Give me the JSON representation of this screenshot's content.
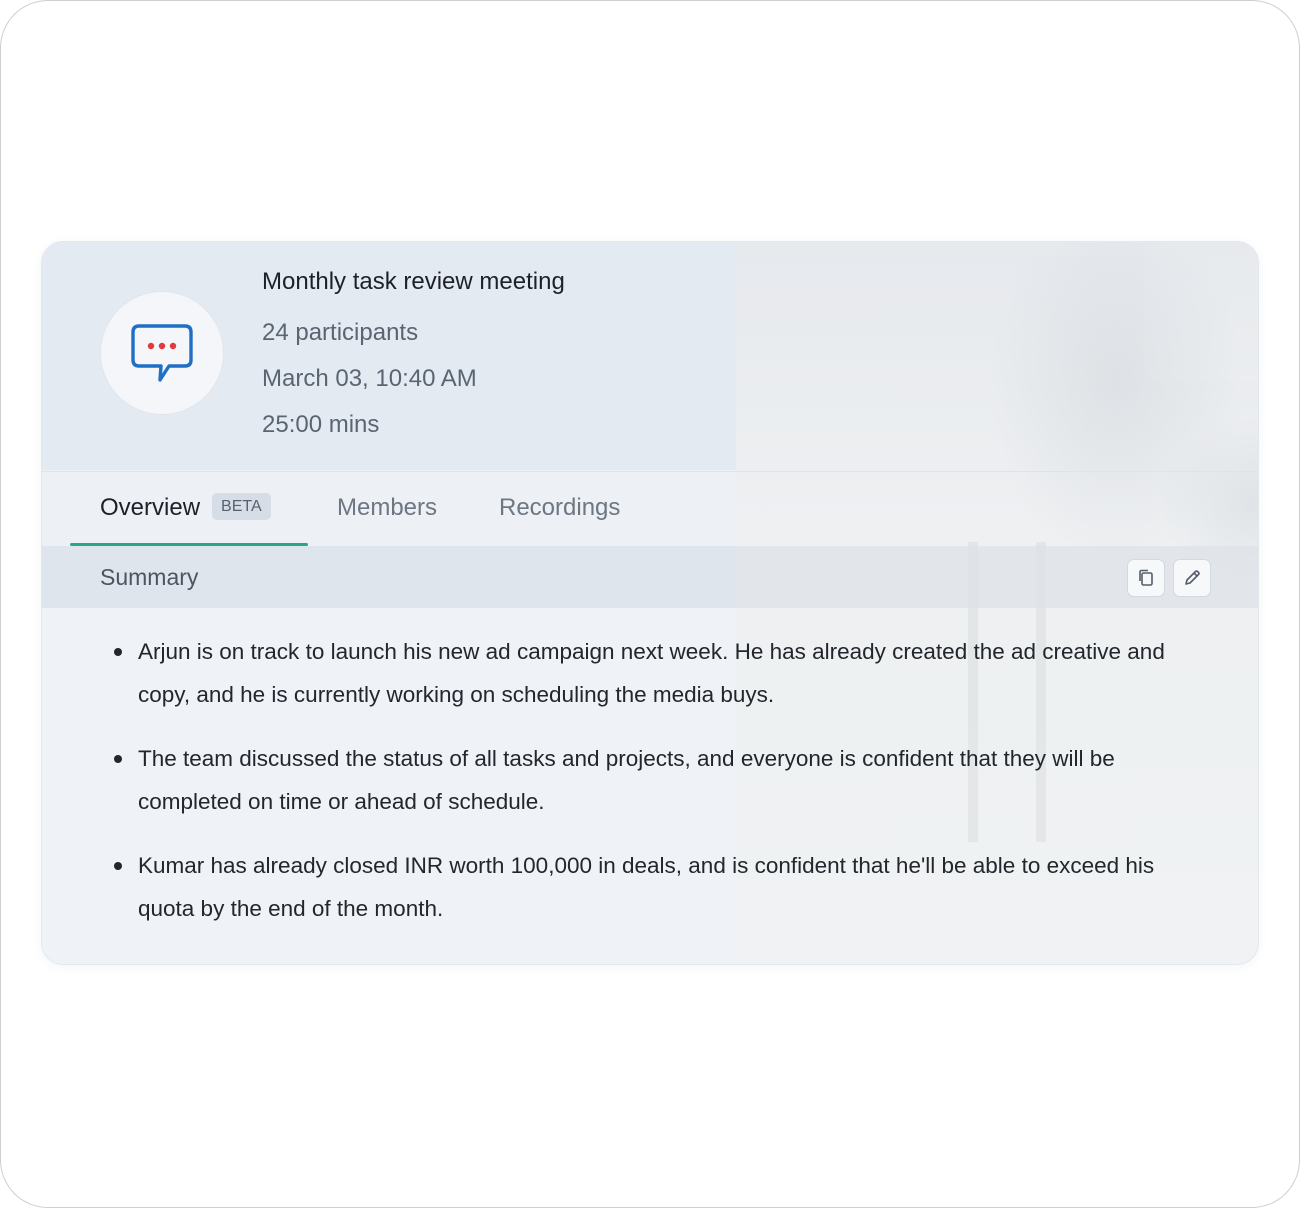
{
  "meeting": {
    "title": "Monthly task review meeting",
    "participants": "24 participants",
    "datetime": "March 03, 10:40 AM",
    "duration": "25:00 mins",
    "icon": "chat-bubble-icon"
  },
  "tabs": [
    {
      "label": "Overview",
      "badge": "BETA",
      "active": true
    },
    {
      "label": "Members",
      "active": false
    },
    {
      "label": "Recordings",
      "active": false
    }
  ],
  "summary": {
    "title": "Summary",
    "actions": {
      "copy_icon": "copy-icon",
      "edit_icon": "edit-pencil-icon"
    },
    "points": [
      "Arjun is on track to launch his new ad campaign next week. He has already created the ad creative and copy, and he is currently working on scheduling the media buys.",
      "The team discussed the status of all tasks and projects, and everyone is confident that they will be completed on time or ahead of schedule.",
      "Kumar has already closed INR worth 100,000 in deals, and is confident that he'll be able to exceed his quota by the end of the month."
    ]
  },
  "colors": {
    "accent": "#27a68c",
    "chat_icon_blue": "#1f6fc5",
    "chat_icon_dots": "#e0393e"
  }
}
